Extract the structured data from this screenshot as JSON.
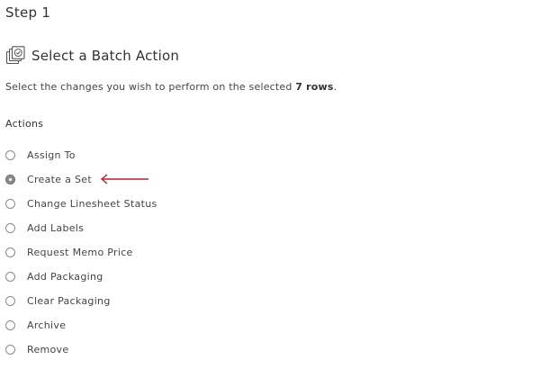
{
  "step": {
    "title": "Step 1"
  },
  "section": {
    "icon": "batch-stack-check-icon",
    "title": "Select a Batch Action"
  },
  "instructions": {
    "prefix": "Select the changes you wish to perform on the selected ",
    "count": "7 rows",
    "suffix": "."
  },
  "actions": {
    "label": "Actions",
    "selected_index": 1,
    "items": [
      {
        "label": "Assign To",
        "checked": false
      },
      {
        "label": "Create a Set",
        "checked": true
      },
      {
        "label": "Change Linesheet Status",
        "checked": false
      },
      {
        "label": "Add Labels",
        "checked": false
      },
      {
        "label": "Request Memo Price",
        "checked": false
      },
      {
        "label": "Add Packaging",
        "checked": false
      },
      {
        "label": "Clear Packaging",
        "checked": false
      },
      {
        "label": "Archive",
        "checked": false
      },
      {
        "label": "Remove",
        "checked": false
      }
    ]
  },
  "annotation": {
    "arrow_color": "#c41e2a",
    "icon": "left-arrow-icon"
  },
  "colors": {
    "text": "#3c3c3c",
    "radio_border": "#8a8a8a",
    "radio_checked": "#8c8c8c"
  }
}
